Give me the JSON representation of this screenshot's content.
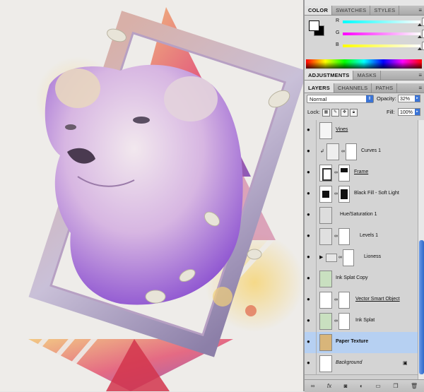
{
  "color_panel": {
    "tabs": [
      "COLOR",
      "SWATCHES",
      "STYLES"
    ],
    "rows": [
      {
        "label": "R",
        "value": "255"
      },
      {
        "label": "G",
        "value": "255"
      },
      {
        "label": "B",
        "value": "255"
      }
    ],
    "menu_icon": "panel-menu-icon"
  },
  "adjustments_panel": {
    "tabs": [
      "ADJUSTMENTS",
      "MASKS"
    ]
  },
  "layers_panel": {
    "tabs": [
      "LAYERS",
      "CHANNELS",
      "PATHS"
    ],
    "blend_mode": "Normal",
    "opacity_label": "Opacity:",
    "opacity_value": "32%",
    "lock_label": "Lock:",
    "fill_label": "Fill:",
    "fill_value": "100%",
    "layers": [
      {
        "name": "Vines",
        "style": "link",
        "selected": false
      },
      {
        "name": "Curves 1",
        "style": "normal",
        "selected": false
      },
      {
        "name": "Frame",
        "style": "link",
        "selected": false
      },
      {
        "name": "Black Fill - Soft Light",
        "style": "normal",
        "selected": false
      },
      {
        "name": "Hue/Saturation 1",
        "style": "normal",
        "selected": false
      },
      {
        "name": "Levels 1",
        "style": "normal",
        "selected": false
      },
      {
        "name": "Lioness",
        "style": "normal",
        "selected": false
      },
      {
        "name": "Ink Splat Copy",
        "style": "normal",
        "selected": false
      },
      {
        "name": "Vector Smart Object",
        "style": "link",
        "selected": false
      },
      {
        "name": "Ink Splat",
        "style": "normal",
        "selected": false
      },
      {
        "name": "Paper Texture",
        "style": "bold",
        "selected": true
      },
      {
        "name": "Background",
        "style": "ital",
        "selected": false
      }
    ],
    "bottom_icons": [
      "link-layers-icon",
      "fx-icon",
      "add-mask-icon",
      "adjustment-layer-icon",
      "new-group-icon",
      "new-layer-icon",
      "trash-icon"
    ]
  }
}
